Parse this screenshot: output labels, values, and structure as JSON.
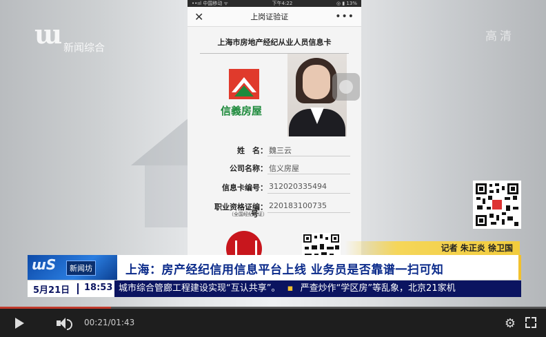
{
  "channel": {
    "logo_mark": "ɯ",
    "logo_name": "新闻综合",
    "hd_label": "高清"
  },
  "phone": {
    "status_left": "••ııl 中国移动 ᯤ",
    "status_time": "下午4:22",
    "status_right": "◎ ▮ 13%",
    "nav_close": "✕",
    "nav_title": "上岗证验证",
    "nav_more": "•••",
    "card_title": "上海市房地产经纪从业人员信息卡",
    "company_name": "信義房屋",
    "fields": [
      {
        "label": "姓　名：",
        "value": "魏三云"
      },
      {
        "label": "公司名称：",
        "value": "信义房屋"
      },
      {
        "label": "信息卡编号：",
        "value": "312020335494"
      },
      {
        "label": "职业资格证编：",
        "value": "220183100735",
        "sub": "（全国经纪人证）",
        "suffix": "号"
      }
    ]
  },
  "reporter": "记者  朱正炎   徐卫国",
  "news_logo": {
    "mark": "ɯS",
    "badge": "新闻坊"
  },
  "headline": "上海：房产经纪信用信息平台上线  业务员是否靠谱一扫可知",
  "date": "5月21日",
  "time": "18:53",
  "ticker": [
    "城市综合管廊工程建设实现“互认共享”。",
    "严查炒作“学区房”等乱象，北京21家机"
  ],
  "ticker_bullet": "▪",
  "player": {
    "current_time": "00:21",
    "duration": "01:43",
    "time_sep": "/",
    "progress_fraction": 0.2039,
    "gear_icon": "⚙"
  }
}
